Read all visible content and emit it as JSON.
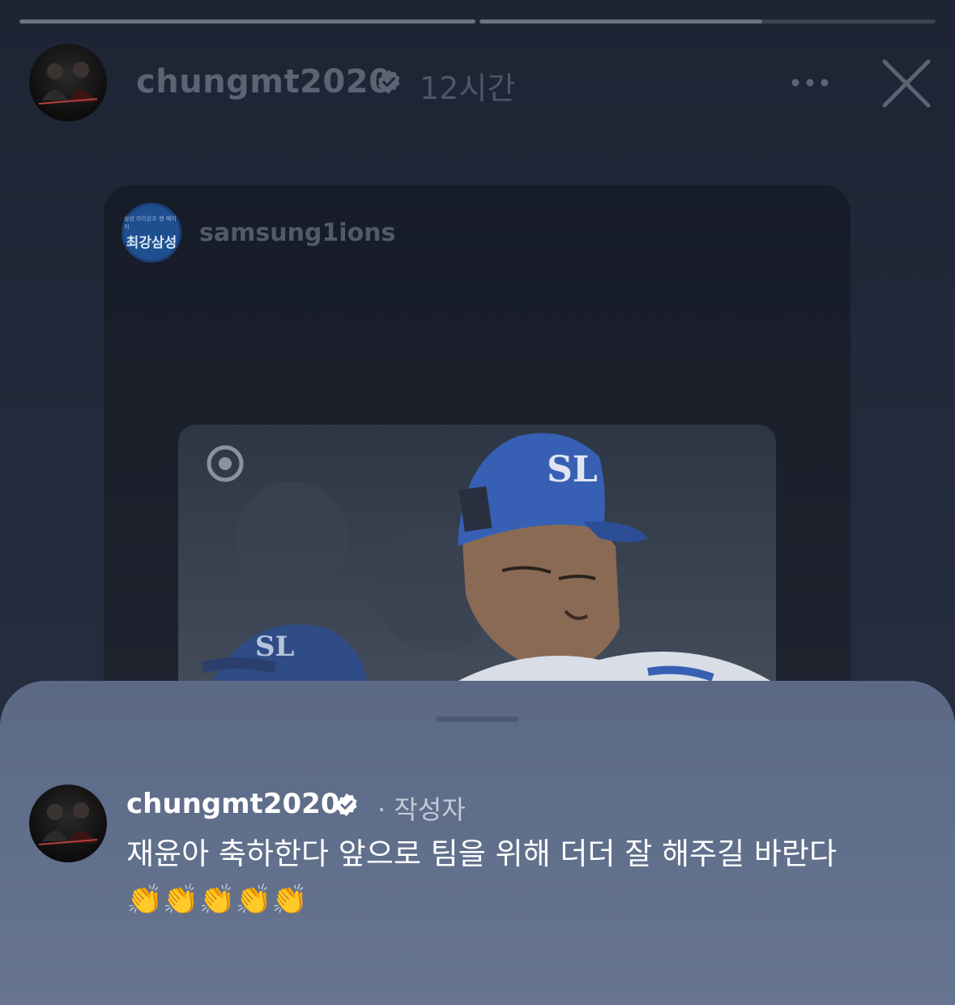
{
  "story": {
    "progress": [
      1.0,
      0.62
    ],
    "username": "chungmt2020",
    "time": "12시간"
  },
  "shared_post": {
    "username": "samsung1ions",
    "avatar_text_small": "삼성 라이온즈 팬 페이지",
    "avatar_text_big": "최강삼성",
    "cap_logo": "SL"
  },
  "comment": {
    "username": "chungmt2020",
    "author_tag": "· 작성자",
    "text": "재윤아 축하한다 앞으로 팀을 위해 더더 잘 해주길 바란다",
    "emojis": "👏👏👏👏👏"
  },
  "colors": {
    "background": "#20283a",
    "sheet": "#5f6e8a",
    "verified": "#ffffff"
  },
  "icons": [
    "verified-badge-icon",
    "more-options-icon",
    "close-icon"
  ]
}
